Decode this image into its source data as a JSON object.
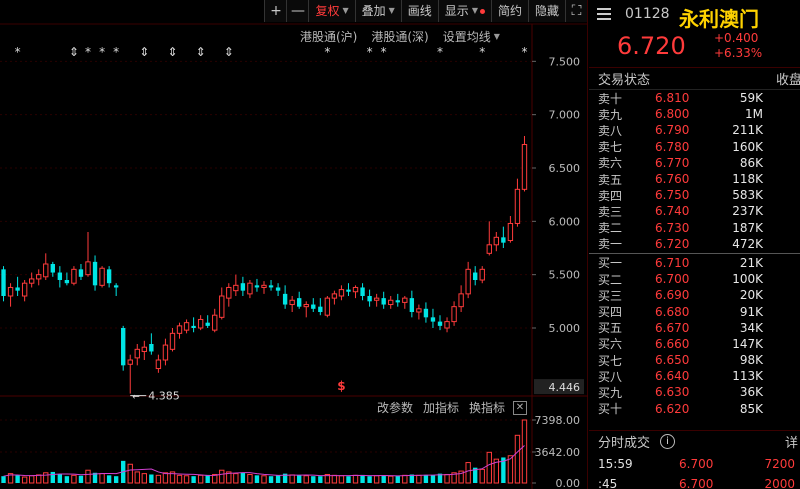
{
  "toolbar": {
    "plus": "+",
    "minus": "—",
    "fuquan": "复权",
    "diejia": "叠加",
    "huaxian": "画线",
    "xianshi": "显示",
    "jianyue": "简约",
    "yincang": "隐藏",
    "fullscreen": "⛶"
  },
  "indicator_tabs": [
    "港股通(沪)",
    "港股通(深)",
    "设置均线"
  ],
  "volume_toolbar": {
    "params": "改参数",
    "add": "加指标",
    "swap": "换指标",
    "close": "✕"
  },
  "chart_data": [
    {
      "type": "candlestick",
      "y_ticks": [
        "7.500",
        "7.000",
        "6.500",
        "6.000",
        "5.500",
        "5.000"
      ],
      "ylim": [
        4.4,
        7.7
      ],
      "current_price_label": "4.446",
      "low_marker": "4.385",
      "special_marker": "$",
      "candles": [
        {
          "o": 5.55,
          "h": 5.58,
          "l": 5.25,
          "c": 5.3,
          "up": false
        },
        {
          "o": 5.3,
          "h": 5.42,
          "l": 5.2,
          "c": 5.38,
          "up": true
        },
        {
          "o": 5.38,
          "h": 5.48,
          "l": 5.3,
          "c": 5.35,
          "up": false
        },
        {
          "o": 5.3,
          "h": 5.45,
          "l": 5.25,
          "c": 5.42,
          "up": true
        },
        {
          "o": 5.42,
          "h": 5.52,
          "l": 5.38,
          "c": 5.46,
          "up": true
        },
        {
          "o": 5.46,
          "h": 5.55,
          "l": 5.4,
          "c": 5.5,
          "up": true
        },
        {
          "o": 5.48,
          "h": 5.7,
          "l": 5.45,
          "c": 5.6,
          "up": true
        },
        {
          "o": 5.6,
          "h": 5.62,
          "l": 5.48,
          "c": 5.52,
          "up": false
        },
        {
          "o": 5.52,
          "h": 5.58,
          "l": 5.38,
          "c": 5.45,
          "up": false
        },
        {
          "o": 5.45,
          "h": 5.52,
          "l": 5.4,
          "c": 5.42,
          "up": false
        },
        {
          "o": 5.42,
          "h": 5.58,
          "l": 5.4,
          "c": 5.55,
          "up": true
        },
        {
          "o": 5.55,
          "h": 5.6,
          "l": 5.45,
          "c": 5.48,
          "up": false
        },
        {
          "o": 5.5,
          "h": 5.9,
          "l": 5.48,
          "c": 5.62,
          "up": true
        },
        {
          "o": 5.62,
          "h": 5.68,
          "l": 5.35,
          "c": 5.4,
          "up": false
        },
        {
          "o": 5.4,
          "h": 5.58,
          "l": 5.38,
          "c": 5.56,
          "up": true
        },
        {
          "o": 5.55,
          "h": 5.58,
          "l": 5.38,
          "c": 5.42,
          "up": false
        },
        {
          "o": 5.4,
          "h": 5.42,
          "l": 5.3,
          "c": 5.38,
          "up": false
        },
        {
          "o": 5.0,
          "h": 5.02,
          "l": 4.6,
          "c": 4.65,
          "up": false
        },
        {
          "o": 4.66,
          "h": 4.75,
          "l": 4.385,
          "c": 4.7,
          "up": true
        },
        {
          "o": 4.72,
          "h": 4.85,
          "l": 4.65,
          "c": 4.8,
          "up": true
        },
        {
          "o": 4.78,
          "h": 4.88,
          "l": 4.7,
          "c": 4.82,
          "up": true
        },
        {
          "o": 4.85,
          "h": 4.95,
          "l": 4.75,
          "c": 4.78,
          "up": false
        },
        {
          "o": 4.62,
          "h": 4.75,
          "l": 4.58,
          "c": 4.7,
          "up": true
        },
        {
          "o": 4.7,
          "h": 4.9,
          "l": 4.65,
          "c": 4.84,
          "up": true
        },
        {
          "o": 4.8,
          "h": 5.0,
          "l": 4.78,
          "c": 4.95,
          "up": true
        },
        {
          "o": 4.95,
          "h": 5.05,
          "l": 4.9,
          "c": 5.02,
          "up": true
        },
        {
          "o": 4.98,
          "h": 5.08,
          "l": 4.95,
          "c": 5.05,
          "up": true
        },
        {
          "o": 5.02,
          "h": 5.1,
          "l": 4.96,
          "c": 5.0,
          "up": false
        },
        {
          "o": 5.0,
          "h": 5.12,
          "l": 4.98,
          "c": 5.08,
          "up": true
        },
        {
          "o": 5.05,
          "h": 5.12,
          "l": 5.0,
          "c": 5.02,
          "up": false
        },
        {
          "o": 4.98,
          "h": 5.18,
          "l": 4.96,
          "c": 5.12,
          "up": true
        },
        {
          "o": 5.1,
          "h": 5.38,
          "l": 5.08,
          "c": 5.3,
          "up": true
        },
        {
          "o": 5.28,
          "h": 5.42,
          "l": 5.2,
          "c": 5.38,
          "up": true
        },
        {
          "o": 5.35,
          "h": 5.5,
          "l": 5.3,
          "c": 5.4,
          "up": true
        },
        {
          "o": 5.42,
          "h": 5.48,
          "l": 5.3,
          "c": 5.35,
          "up": false
        },
        {
          "o": 5.32,
          "h": 5.45,
          "l": 5.28,
          "c": 5.42,
          "up": true
        },
        {
          "o": 5.4,
          "h": 5.46,
          "l": 5.34,
          "c": 5.38,
          "up": false
        },
        {
          "o": 5.38,
          "h": 5.44,
          "l": 5.32,
          "c": 5.4,
          "up": true
        },
        {
          "o": 5.4,
          "h": 5.45,
          "l": 5.35,
          "c": 5.38,
          "up": false
        },
        {
          "o": 5.38,
          "h": 5.42,
          "l": 5.3,
          "c": 5.35,
          "up": false
        },
        {
          "o": 5.32,
          "h": 5.4,
          "l": 5.18,
          "c": 5.22,
          "up": false
        },
        {
          "o": 5.22,
          "h": 5.3,
          "l": 5.15,
          "c": 5.26,
          "up": true
        },
        {
          "o": 5.28,
          "h": 5.34,
          "l": 5.18,
          "c": 5.2,
          "up": false
        },
        {
          "o": 5.2,
          "h": 5.25,
          "l": 5.1,
          "c": 5.22,
          "up": true
        },
        {
          "o": 5.22,
          "h": 5.28,
          "l": 5.15,
          "c": 5.18,
          "up": false
        },
        {
          "o": 5.2,
          "h": 5.28,
          "l": 5.12,
          "c": 5.15,
          "up": false
        },
        {
          "o": 5.12,
          "h": 5.3,
          "l": 5.1,
          "c": 5.28,
          "up": true
        },
        {
          "o": 5.28,
          "h": 5.35,
          "l": 5.22,
          "c": 5.32,
          "up": true
        },
        {
          "o": 5.3,
          "h": 5.4,
          "l": 5.26,
          "c": 5.36,
          "up": true
        },
        {
          "o": 5.36,
          "h": 5.42,
          "l": 5.3,
          "c": 5.34,
          "up": false
        },
        {
          "o": 5.34,
          "h": 5.4,
          "l": 5.28,
          "c": 5.38,
          "up": true
        },
        {
          "o": 5.38,
          "h": 5.42,
          "l": 5.26,
          "c": 5.3,
          "up": false
        },
        {
          "o": 5.3,
          "h": 5.36,
          "l": 5.2,
          "c": 5.25,
          "up": false
        },
        {
          "o": 5.26,
          "h": 5.32,
          "l": 5.2,
          "c": 5.28,
          "up": true
        },
        {
          "o": 5.28,
          "h": 5.34,
          "l": 5.18,
          "c": 5.22,
          "up": false
        },
        {
          "o": 5.22,
          "h": 5.3,
          "l": 5.18,
          "c": 5.26,
          "up": true
        },
        {
          "o": 5.26,
          "h": 5.32,
          "l": 5.2,
          "c": 5.24,
          "up": false
        },
        {
          "o": 5.24,
          "h": 5.3,
          "l": 5.18,
          "c": 5.28,
          "up": true
        },
        {
          "o": 5.28,
          "h": 5.35,
          "l": 5.1,
          "c": 5.15,
          "up": false
        },
        {
          "o": 5.15,
          "h": 5.22,
          "l": 5.08,
          "c": 5.18,
          "up": true
        },
        {
          "o": 5.18,
          "h": 5.24,
          "l": 5.05,
          "c": 5.1,
          "up": false
        },
        {
          "o": 5.1,
          "h": 5.18,
          "l": 5.0,
          "c": 5.06,
          "up": false
        },
        {
          "o": 5.06,
          "h": 5.12,
          "l": 4.98,
          "c": 5.02,
          "up": false
        },
        {
          "o": 5.0,
          "h": 5.1,
          "l": 4.96,
          "c": 5.06,
          "up": true
        },
        {
          "o": 5.06,
          "h": 5.25,
          "l": 5.02,
          "c": 5.2,
          "up": true
        },
        {
          "o": 5.2,
          "h": 5.4,
          "l": 5.15,
          "c": 5.32,
          "up": true
        },
        {
          "o": 5.32,
          "h": 5.62,
          "l": 5.28,
          "c": 5.55,
          "up": true
        },
        {
          "o": 5.52,
          "h": 5.58,
          "l": 5.4,
          "c": 5.45,
          "up": false
        },
        {
          "o": 5.45,
          "h": 5.58,
          "l": 5.42,
          "c": 5.55,
          "up": true
        },
        {
          "o": 5.7,
          "h": 6.0,
          "l": 5.68,
          "c": 5.78,
          "up": true
        },
        {
          "o": 5.78,
          "h": 5.9,
          "l": 5.72,
          "c": 5.85,
          "up": true
        },
        {
          "o": 5.85,
          "h": 5.95,
          "l": 5.75,
          "c": 5.8,
          "up": false
        },
        {
          "o": 5.82,
          "h": 6.05,
          "l": 5.8,
          "c": 5.98,
          "up": true
        },
        {
          "o": 5.98,
          "h": 6.4,
          "l": 5.95,
          "c": 6.3,
          "up": true
        },
        {
          "o": 6.3,
          "h": 6.8,
          "l": 6.28,
          "c": 6.72,
          "up": true
        }
      ]
    },
    {
      "type": "bar",
      "title": "volume",
      "y_ticks": [
        "7398.00",
        "3642.00",
        "0.00"
      ],
      "ylim": [
        0,
        7398
      ],
      "values": [
        800,
        1100,
        900,
        700,
        850,
        950,
        1200,
        1300,
        1000,
        800,
        900,
        850,
        1500,
        1200,
        1100,
        900,
        800,
        2600,
        2200,
        1300,
        1100,
        1000,
        900,
        1200,
        1300,
        900,
        850,
        800,
        900,
        950,
        1000,
        1500,
        1300,
        1100,
        1200,
        1000,
        900,
        850,
        800,
        900,
        1100,
        950,
        900,
        850,
        800,
        800,
        1000,
        900,
        850,
        800,
        900,
        950,
        800,
        850,
        900,
        800,
        850,
        900,
        1000,
        900,
        950,
        900,
        1100,
        1000,
        1200,
        1400,
        2400,
        1800,
        1600,
        3600,
        2800,
        3000,
        3200,
        5600,
        7398
      ]
    }
  ],
  "quote": {
    "code": "01128",
    "name": "永利澳门",
    "price": "6.720",
    "change": "+0.400",
    "change_pct": "+6.33%"
  },
  "orderbook": {
    "title": "交易状态",
    "status": "收盘",
    "asks": [
      {
        "label": "卖十",
        "price": "6.810",
        "qty": "59K"
      },
      {
        "label": "卖九",
        "price": "6.800",
        "qty": "1M"
      },
      {
        "label": "卖八",
        "price": "6.790",
        "qty": "211K"
      },
      {
        "label": "卖七",
        "price": "6.780",
        "qty": "160K"
      },
      {
        "label": "卖六",
        "price": "6.770",
        "qty": "86K"
      },
      {
        "label": "卖五",
        "price": "6.760",
        "qty": "118K"
      },
      {
        "label": "卖四",
        "price": "6.750",
        "qty": "583K"
      },
      {
        "label": "卖三",
        "price": "6.740",
        "qty": "237K"
      },
      {
        "label": "卖二",
        "price": "6.730",
        "qty": "187K"
      },
      {
        "label": "卖一",
        "price": "6.720",
        "qty": "472K"
      }
    ],
    "bids": [
      {
        "label": "买一",
        "price": "6.710",
        "qty": "21K"
      },
      {
        "label": "买二",
        "price": "6.700",
        "qty": "100K"
      },
      {
        "label": "买三",
        "price": "6.690",
        "qty": "20K"
      },
      {
        "label": "买四",
        "price": "6.680",
        "qty": "91K"
      },
      {
        "label": "买五",
        "price": "6.670",
        "qty": "34K"
      },
      {
        "label": "买六",
        "price": "6.660",
        "qty": "147K"
      },
      {
        "label": "买七",
        "price": "6.650",
        "qty": "98K"
      },
      {
        "label": "买八",
        "price": "6.640",
        "qty": "113K"
      },
      {
        "label": "买九",
        "price": "6.630",
        "qty": "36K"
      },
      {
        "label": "买十",
        "price": "6.620",
        "qty": "85K"
      }
    ]
  },
  "ticks": {
    "title": "分时成交",
    "info_icon": "i",
    "detail": "详",
    "rows": [
      {
        "time": "15:59",
        "price": "6.700",
        "vol": "7200"
      },
      {
        "time": ":45",
        "price": "6.700",
        "vol": "2000"
      }
    ]
  },
  "colors": {
    "up": "#ff3b3b",
    "down": "#00e5e5",
    "ma": "#d040d0",
    "accent": "#ffd200"
  }
}
